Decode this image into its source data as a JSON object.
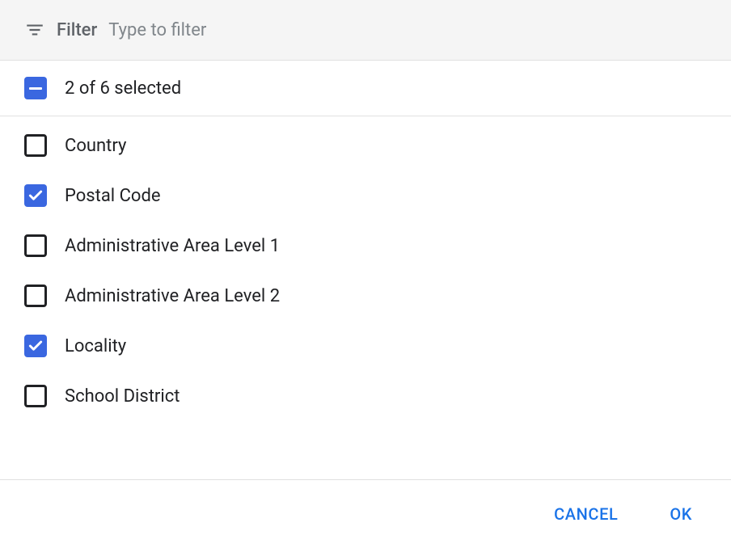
{
  "filter": {
    "label": "Filter",
    "placeholder": "Type to filter"
  },
  "selection": {
    "summary": "2 of 6 selected"
  },
  "options": [
    {
      "label": "Country",
      "checked": false
    },
    {
      "label": "Postal Code",
      "checked": true
    },
    {
      "label": "Administrative Area Level 1",
      "checked": false
    },
    {
      "label": "Administrative Area Level 2",
      "checked": false
    },
    {
      "label": "Locality",
      "checked": true
    },
    {
      "label": "School District",
      "checked": false
    }
  ],
  "actions": {
    "cancel": "CANCEL",
    "ok": "OK"
  }
}
